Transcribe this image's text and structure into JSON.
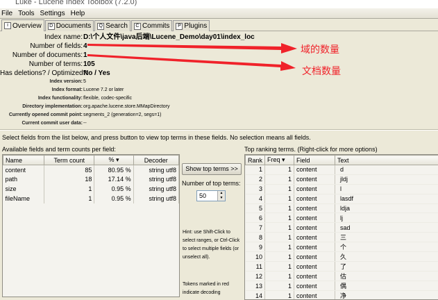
{
  "window": {
    "title": "Luke - Lucene Index Toolbox (7.2.0)"
  },
  "menu": [
    "File",
    "Tools",
    "Settings",
    "Help"
  ],
  "tabs": [
    {
      "label": "Overview",
      "icon": "info-icon",
      "active": true
    },
    {
      "label": "Documents",
      "icon": "document-icon"
    },
    {
      "label": "Search",
      "icon": "search-icon"
    },
    {
      "label": "Commits",
      "icon": "commits-icon"
    },
    {
      "label": "Plugins",
      "icon": "plugins-icon"
    }
  ],
  "overview": {
    "main": [
      {
        "label": "Index name:",
        "value": "D:\\个人文件\\java后端\\Lucene_Demo\\day01\\index_loc"
      },
      {
        "label": "Number of fields:",
        "value": "4"
      },
      {
        "label": "Number of documents:",
        "value": "1"
      },
      {
        "label": "Number of terms:",
        "value": "105"
      },
      {
        "label": "Has deletions? / Optimized?:",
        "value": "No / Yes"
      }
    ],
    "details": [
      {
        "label": "Index version:",
        "value": "5"
      },
      {
        "label": "Index format:",
        "value": "Lucene 7.2 or later"
      },
      {
        "label": "Index functionality:",
        "value": "flexible, codec-specific"
      },
      {
        "label": "Directory implementation:",
        "value": "org.apache.lucene.store.MMapDirectory"
      },
      {
        "label": "Currently opened commit point:",
        "value": "segments_2 (generation=2, segs=1)"
      },
      {
        "label": "Current commit user data:",
        "value": "--"
      }
    ]
  },
  "annotations": {
    "fields": "域的数量",
    "documents": "文档数量",
    "color": "#f0222a"
  },
  "instructions": "Select fields from the list below, and press button to view top terms in these fields. No selection means all fields.",
  "fields_table": {
    "caption": "Available fields and term counts per field:",
    "columns": [
      "Name",
      "Term count",
      "%  ▾",
      "Decoder"
    ],
    "rows": [
      [
        "content",
        "85",
        "80.95 %",
        "string utf8"
      ],
      [
        "path",
        "18",
        "17.14 %",
        "string utf8"
      ],
      [
        "size",
        "1",
        "0.95 %",
        "string utf8"
      ],
      [
        "fileName",
        "1",
        "0.95 %",
        "string utf8"
      ]
    ]
  },
  "controls": {
    "show_top_terms": "Show top terms >>",
    "num_top_terms_label": "Number of top terms:",
    "num_top_terms": "50",
    "hint": "Hint: use Shift-Click to select ranges, or Ctrl-Click to select multiple fields (or unselect all).",
    "tokens_note": "Tokens marked in red indicate decoding"
  },
  "top_terms": {
    "caption": "Top ranking terms. (Right-click for more options)",
    "columns": [
      "Rank",
      "Freq   ▾",
      "Field",
      "Text"
    ],
    "rows": [
      [
        "1",
        "1",
        "content",
        "d"
      ],
      [
        "2",
        "1",
        "content",
        "jldj"
      ],
      [
        "3",
        "1",
        "content",
        "l"
      ],
      [
        "4",
        "1",
        "content",
        "lasdf"
      ],
      [
        "5",
        "1",
        "content",
        "ldja"
      ],
      [
        "6",
        "1",
        "content",
        "lj"
      ],
      [
        "7",
        "1",
        "content",
        "sad"
      ],
      [
        "8",
        "1",
        "content",
        "三"
      ],
      [
        "9",
        "1",
        "content",
        "个"
      ],
      [
        "10",
        "1",
        "content",
        "久"
      ],
      [
        "11",
        "1",
        "content",
        "了"
      ],
      [
        "12",
        "1",
        "content",
        "估"
      ],
      [
        "13",
        "1",
        "content",
        "偶"
      ],
      [
        "14",
        "1",
        "content",
        "净"
      ]
    ]
  }
}
